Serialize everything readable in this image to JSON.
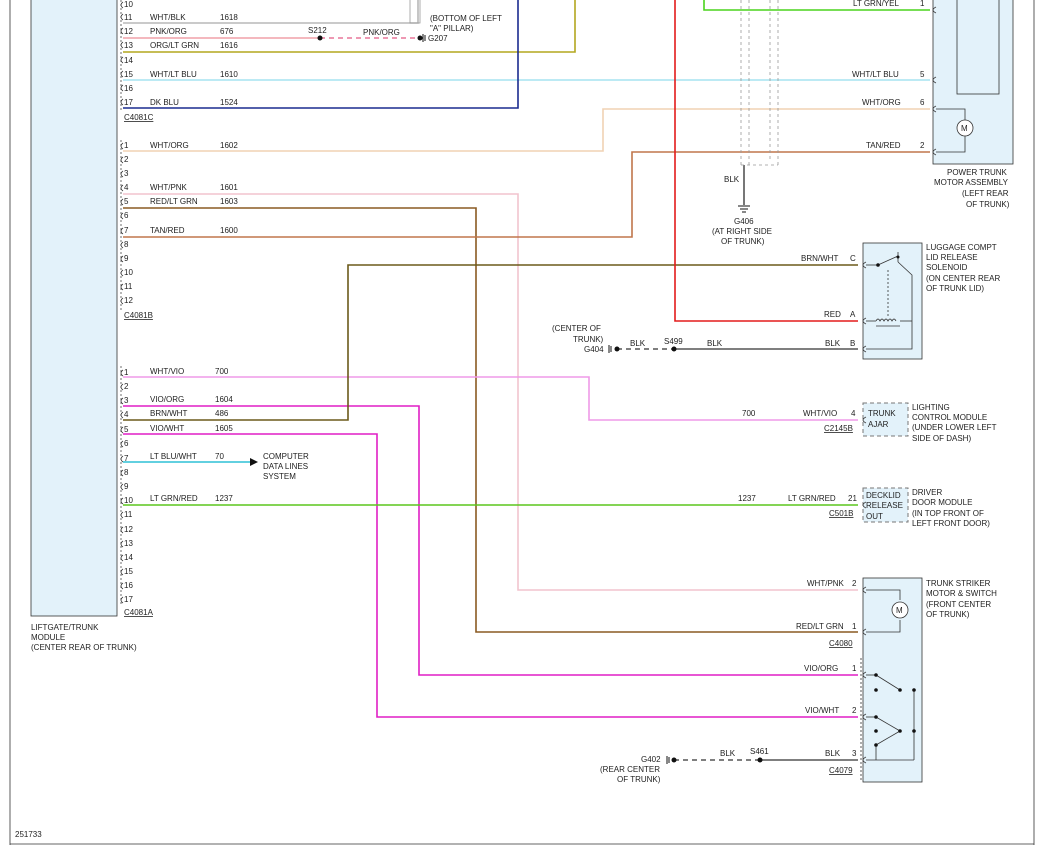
{
  "colors": {
    "blue": "#1a2b8f",
    "olive": "#b3a71f",
    "light_blue": "#a6e4f0",
    "tan_light": "#f0d2b4",
    "tan": "#c0764b",
    "pink": "#f2c4ce",
    "brown": "#6d4a12",
    "brown_olive": "#6b5a1a",
    "violet_light": "#e58ce8",
    "magenta": "#e01fc5",
    "teal": "#2ec1d6",
    "green": "#5cc61d",
    "red": "#e31b1b",
    "grey": "#555555",
    "pink_dash": "#e8779a",
    "wire_green": "#4ad31d"
  },
  "module": {
    "name": [
      "LIFTGATE/TRUNK",
      "MODULE",
      "(CENTER REAR OF TRUNK)"
    ],
    "connectors": {
      "c": "C4081C",
      "b": "C4081B",
      "a": "C4081A"
    },
    "pins_c": [
      "10",
      "11",
      "12",
      "13",
      "14",
      "15",
      "16",
      "17"
    ],
    "pins_b": [
      "1",
      "2",
      "3",
      "4",
      "5",
      "6",
      "7",
      "8",
      "9",
      "10",
      "11",
      "12"
    ],
    "pins_a": [
      "1",
      "2",
      "3",
      "4",
      "5",
      "6",
      "7",
      "8",
      "9",
      "10",
      "11",
      "12",
      "13",
      "14",
      "15",
      "16",
      "17"
    ]
  },
  "wires_c": [
    {
      "pin": "11",
      "color": "WHT/BLK",
      "circuit": "1618"
    },
    {
      "pin": "12",
      "color": "PNK/ORG",
      "circuit": "676"
    },
    {
      "pin": "13",
      "color": "ORG/LT GRN",
      "circuit": "1616"
    },
    {
      "pin": "15",
      "color": "WHT/LT BLU",
      "circuit": "1610"
    },
    {
      "pin": "17",
      "color": "DK BLU",
      "circuit": "1524"
    }
  ],
  "wires_b": [
    {
      "pin": "1",
      "color": "WHT/ORG",
      "circuit": "1602"
    },
    {
      "pin": "4",
      "color": "WHT/PNK",
      "circuit": "1601"
    },
    {
      "pin": "5",
      "color": "RED/LT GRN",
      "circuit": "1603"
    },
    {
      "pin": "7",
      "color": "TAN/RED",
      "circuit": "1600"
    }
  ],
  "wires_a": [
    {
      "pin": "1",
      "color": "WHT/VIO",
      "circuit": "700"
    },
    {
      "pin": "3",
      "color": "VIO/ORG",
      "circuit": "1604"
    },
    {
      "pin": "4",
      "color": "BRN/WHT",
      "circuit": "486"
    },
    {
      "pin": "5",
      "color": "VIO/WHT",
      "circuit": "1605"
    },
    {
      "pin": "7",
      "color": "LT BLU/WHT",
      "circuit": "70"
    },
    {
      "pin": "10",
      "color": "LT GRN/RED",
      "circuit": "1237"
    }
  ],
  "splices": {
    "s212": "S212",
    "g207": "G207",
    "s499": "S499",
    "s461": "S461"
  },
  "pillar_note": [
    "(BOTTOM OF LEFT",
    "\"A\" PILLAR)"
  ],
  "computer_data": [
    "COMPUTER",
    "DATA LINES",
    "SYSTEM"
  ],
  "ground_g406": {
    "wire": "BLK",
    "name": "G406",
    "location": [
      "(AT RIGHT SIDE",
      "OF TRUNK)"
    ]
  },
  "ground_g404": {
    "name": "G404",
    "location": [
      "(CENTER OF",
      "TRUNK)"
    ],
    "wire1": "BLK",
    "wire2": "BLK"
  },
  "ground_g402": {
    "name": "G402",
    "location": [
      "(REAR CENTER",
      "OF TRUNK)"
    ],
    "wire": "BLK"
  },
  "power_trunk_motor": {
    "title": [
      "POWER TRUNK",
      "MOTOR ASSEMBLY",
      "(LEFT REAR",
      "OF TRUNK)"
    ],
    "wires": [
      {
        "color": "LT GRN/YEL",
        "pin": "1"
      },
      {
        "color": "WHT/LT BLU",
        "pin": "5"
      },
      {
        "color": "WHT/ORG",
        "pin": "6"
      },
      {
        "color": "TAN/RED",
        "pin": "2"
      }
    ],
    "motor": "M"
  },
  "luggage_solenoid": {
    "title": [
      "LUGGAGE COMPT",
      "LID RELEASE",
      "SOLENOID",
      "(ON CENTER REAR",
      "OF TRUNK LID)"
    ],
    "wires": [
      {
        "color": "BRN/WHT",
        "pin": "C"
      },
      {
        "color": "RED",
        "pin": "A"
      },
      {
        "color": "BLK",
        "pin": "B"
      }
    ]
  },
  "lighting_module": {
    "title": [
      "LIGHTING",
      "CONTROL MODULE",
      "(UNDER LOWER LEFT",
      "SIDE OF DASH)"
    ],
    "circuit": "700",
    "color": "WHT/VIO",
    "pin": "4",
    "connector": "C2145B",
    "label": [
      "TRUNK",
      "AJAR"
    ]
  },
  "driver_door_module": {
    "title": [
      "DRIVER",
      "DOOR MODULE",
      "(IN TOP FRONT OF",
      "LEFT FRONT DOOR)"
    ],
    "circuit": "1237",
    "color": "LT GRN/RED",
    "pin": "21",
    "connector": "C501B",
    "label": [
      "DECKLID",
      "RELEASE",
      "OUT"
    ]
  },
  "trunk_striker": {
    "title": [
      "TRUNK STRIKER",
      "MOTOR & SWITCH",
      "(FRONT CENTER",
      "OF TRUNK)"
    ],
    "wires_top": [
      {
        "color": "WHT/PNK",
        "pin": "2"
      },
      {
        "color": "RED/LT GRN",
        "pin": "1"
      }
    ],
    "connector_top": "C4080",
    "wires_bottom": [
      {
        "color": "VIO/ORG",
        "pin": "1"
      },
      {
        "color": "VIO/WHT",
        "pin": "2"
      },
      {
        "color": "BLK",
        "pin": "3"
      }
    ],
    "connector_bottom": "C4079",
    "motor": "M"
  },
  "figure_id": "251733"
}
